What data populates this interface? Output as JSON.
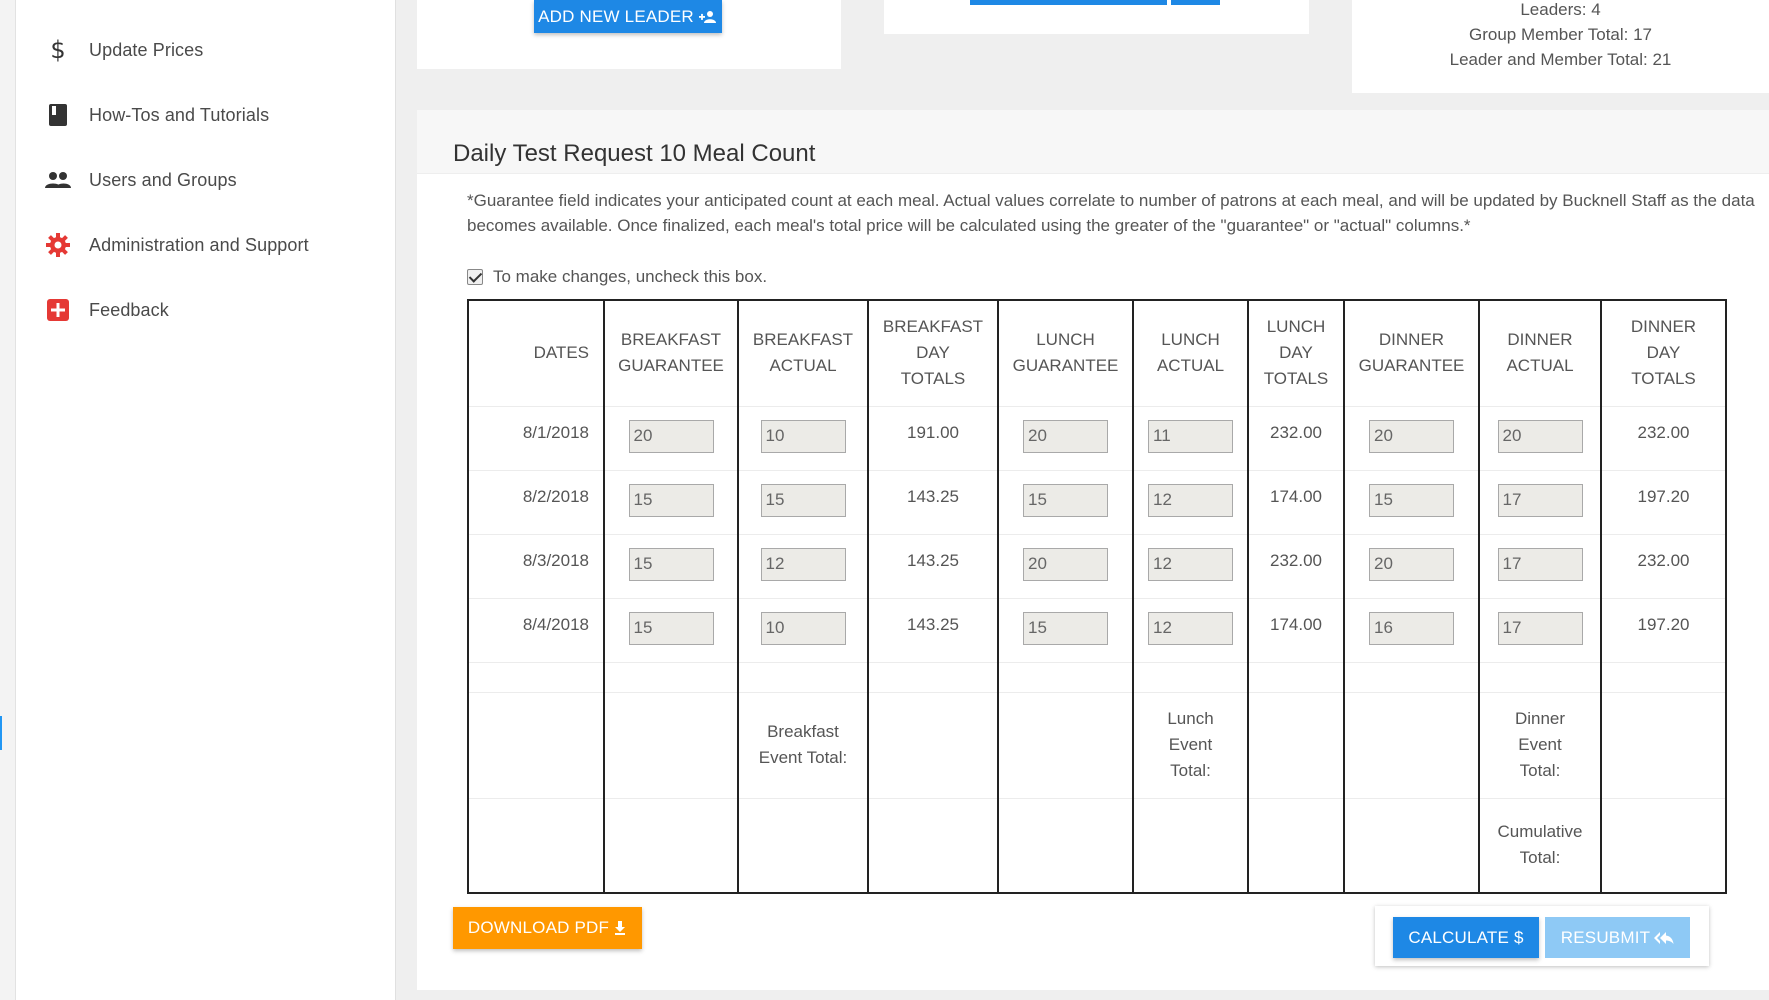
{
  "sidebar": {
    "items": [
      {
        "label": "Update Prices",
        "icon": "dollar-icon"
      },
      {
        "label": "How-Tos and Tutorials",
        "icon": "book-icon"
      },
      {
        "label": "Users and Groups",
        "icon": "people-icon"
      },
      {
        "label": "Administration and Support",
        "icon": "gear-icon"
      },
      {
        "label": "Feedback",
        "icon": "feedback-plus-icon"
      }
    ]
  },
  "top": {
    "add_leader_label": "ADD NEW LEADER",
    "stats": {
      "leaders": "Leaders: 4",
      "member_total": "Group Member Total: 17",
      "leader_member_total": "Leader and Member Total: 21"
    }
  },
  "panel": {
    "title": "Daily Test Request 10 Meal Count",
    "notice": "*Guarantee field indicates your anticipated count at each meal. Actual values correlate to number of patrons at each meal, and will be updated by Bucknell Staff as the data becomes available. Once finalized, each meal's total price will be calculated using the greater of the \"guarantee\" or \"actual\" columns.*",
    "checkbox_label": "To make changes, uncheck this box.",
    "checkbox_checked": true
  },
  "table": {
    "headers": {
      "dates": "DATES",
      "bg1": "BREAKFAST",
      "bg2": "GUARANTEE",
      "ba1": "BREAKFAST",
      "ba2": "ACTUAL",
      "bt1": "BREAKFAST",
      "bt2": "DAY",
      "bt3": "TOTALS",
      "lg1": "LUNCH",
      "lg2": "GUARANTEE",
      "la1": "LUNCH",
      "la2": "ACTUAL",
      "lt1": "LUNCH",
      "lt2": "DAY",
      "lt3": "TOTALS",
      "dg1": "DINNER",
      "dg2": "GUARANTEE",
      "da1": "DINNER",
      "da2": "ACTUAL",
      "dt1": "DINNER",
      "dt2": "DAY",
      "dt3": "TOTALS"
    },
    "rows": [
      {
        "date": "8/1/2018",
        "bg": "20",
        "ba": "10",
        "bt": "191.00",
        "lg": "20",
        "la": "11",
        "lt": "232.00",
        "dg": "20",
        "da": "20",
        "dt": "232.00"
      },
      {
        "date": "8/2/2018",
        "bg": "15",
        "ba": "15",
        "bt": "143.25",
        "lg": "15",
        "la": "12",
        "lt": "174.00",
        "dg": "15",
        "da": "17",
        "dt": "197.20"
      },
      {
        "date": "8/3/2018",
        "bg": "15",
        "ba": "12",
        "bt": "143.25",
        "lg": "20",
        "la": "12",
        "lt": "232.00",
        "dg": "20",
        "da": "17",
        "dt": "232.00"
      },
      {
        "date": "8/4/2018",
        "bg": "15",
        "ba": "10",
        "bt": "143.25",
        "lg": "15",
        "la": "12",
        "lt": "174.00",
        "dg": "16",
        "da": "17",
        "dt": "197.20"
      }
    ],
    "footer": {
      "breakfast_l1": "Breakfast",
      "breakfast_l2": "Event Total:",
      "lunch_l1": "Lunch",
      "lunch_l2": "Event",
      "lunch_l3": "Total:",
      "dinner_l1": "Dinner",
      "dinner_l2": "Event",
      "dinner_l3": "Total:",
      "cum_l1": "Cumulative",
      "cum_l2": "Total:"
    }
  },
  "actions": {
    "download_pdf": "DOWNLOAD PDF",
    "calculate": "CALCULATE $",
    "resubmit": "RESUBMIT"
  },
  "colors": {
    "primary_blue": "#1e88e5",
    "orange": "#ff9800",
    "disabled_blue": "#8ec9f5",
    "red_icon": "#e53935"
  }
}
